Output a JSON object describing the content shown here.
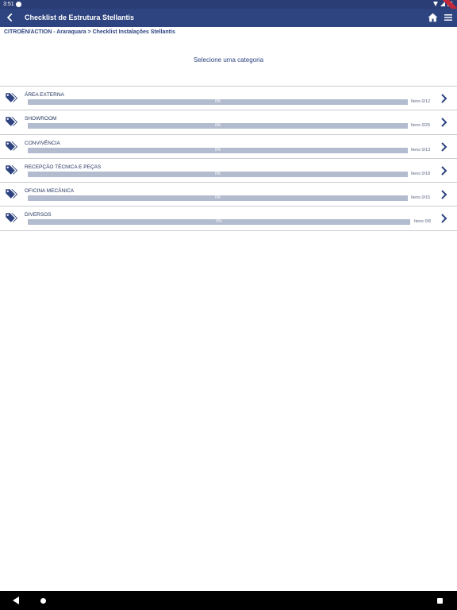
{
  "status_bar": {
    "time": "3:51"
  },
  "app_bar": {
    "title": "Checklist de Estrutura Stellantis"
  },
  "breadcrumb": "CITROËN/ACTION - Araraquara > Checklist Instalações Stellantis",
  "heading": "Selecione uma categoria",
  "categories": [
    {
      "name": "ÁREA EXTERNA",
      "progress_label": "0%",
      "progress": 0,
      "items": "Itens 0/12"
    },
    {
      "name": "SHOWROOM",
      "progress_label": "0%",
      "progress": 0,
      "items": "Itens 0/25"
    },
    {
      "name": "CONVIVÊNCIA",
      "progress_label": "0%",
      "progress": 0,
      "items": "Itens 0/13"
    },
    {
      "name": "RECEPÇÃO TÉCNICA E PEÇAS",
      "progress_label": "0%",
      "progress": 0,
      "items": "Itens 0/18"
    },
    {
      "name": "OFICINA MECÂNICA",
      "progress_label": "0%",
      "progress": 0,
      "items": "Itens 0/15"
    },
    {
      "name": "DIVERSOS",
      "progress_label": "0%",
      "progress": 0,
      "items": "Itens 0/8"
    }
  ],
  "colors": {
    "primary": "#2e4480",
    "status_bar": "#2b3d75",
    "progress_track": "#b3bccf",
    "divider": "#c9cbd1"
  },
  "icons": {
    "back": "arrow-back-icon",
    "home": "home-icon",
    "menu": "menu-icon",
    "category": "tags-icon",
    "row": "chevron-right-icon"
  }
}
